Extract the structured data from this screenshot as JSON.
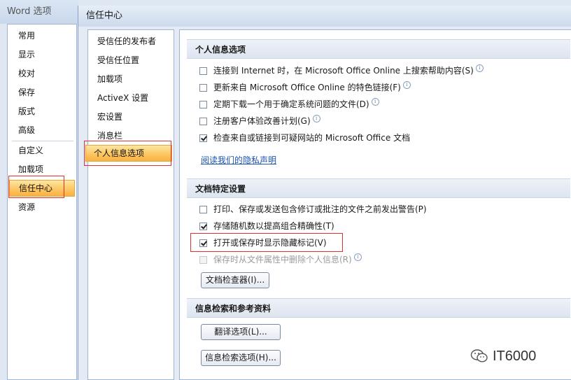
{
  "outer_window": {
    "title": "Word 选项",
    "nav": [
      "常用",
      "显示",
      "校对",
      "保存",
      "版式",
      "高级",
      "自定义",
      "加载项",
      "信任中心",
      "资源"
    ],
    "selected": "信任中心"
  },
  "trust_center": {
    "title": "信任中心",
    "nav": [
      "受信任的发布者",
      "受信任位置",
      "加载项",
      "ActiveX 设置",
      "宏设置",
      "消息栏",
      "个人信息选项"
    ],
    "selected": "个人信息选项"
  },
  "sections": {
    "personal": {
      "title": "个人信息选项",
      "options": [
        {
          "label": "连接到 Internet 时，在 Microsoft Office Online 上搜索帮助内容(S)",
          "checked": false,
          "info": true
        },
        {
          "label": "更新来自 Microsoft Office Online 的特色链接(F)",
          "checked": false,
          "info": true
        },
        {
          "label": "定期下载一个用于确定系统问题的文件(D)",
          "checked": false,
          "info": true
        },
        {
          "label": "注册客户体验改善计划(G)",
          "checked": false,
          "info": true
        },
        {
          "label": "检查来自或链接到可疑网站的 Microsoft Office 文档",
          "checked": true,
          "info": false
        }
      ],
      "privacy_link": "阅读我们的隐私声明"
    },
    "document": {
      "title": "文档特定设置",
      "options": [
        {
          "label": "打印、保存或发送包含修订或批注的文件之前发出警告(P)",
          "checked": false,
          "info": false
        },
        {
          "label": "存储随机数以提高组合精确性(T)",
          "checked": true,
          "info": false
        },
        {
          "label": "打开或保存时显示隐藏标记(V)",
          "checked": true,
          "info": false
        },
        {
          "label": "保存时从文件属性中删除个人信息(R)",
          "checked": false,
          "disabled": true,
          "info": true
        }
      ],
      "inspector_button": "文档检查器(I)..."
    },
    "research": {
      "title": "信息检索和参考资料",
      "translate_button": "翻译选项(L)...",
      "research_button": "信息检索选项(H)..."
    }
  },
  "info_glyph": "i",
  "watermark": {
    "text": "IT6000",
    "icon": "wechat-icon"
  }
}
